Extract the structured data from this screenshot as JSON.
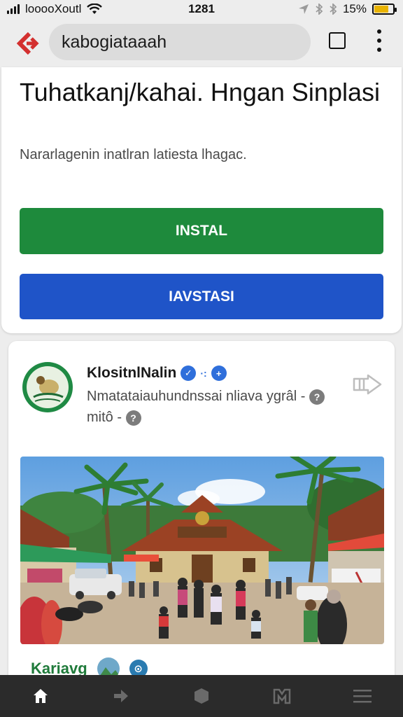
{
  "status": {
    "carrier": "looooXoutl",
    "time": "1281",
    "battery": "15%",
    "battery_level": 0.75
  },
  "browser": {
    "url": "kabogiataaah"
  },
  "card": {
    "title": "Tuhatkanj/kahai. Hngan Sinplasi",
    "subtitle": "Nararlagenin inatlran latiesta lhagac.",
    "install_label": "INSTAL",
    "install2_label": "IAVSTASI"
  },
  "post": {
    "name": "KlositnlNalin",
    "description": "Nmatataiauhundnssai nliava ygrâl -",
    "description2": "mitô -",
    "footer_label": "Kariavg"
  },
  "colors": {
    "green": "#1e8a3c",
    "blue": "#1f54c8",
    "accent_red": "#d3302f"
  },
  "icons": [
    "wifi-icon",
    "navigation-arrow-icon",
    "bluetooth-icon",
    "back-logo-icon",
    "tabs-icon",
    "more-vert-icon",
    "verified-badge-icon",
    "help-icon",
    "share-icon",
    "home-icon",
    "forward-icon",
    "cube-icon",
    "bookmark-icon",
    "menu-icon"
  ]
}
